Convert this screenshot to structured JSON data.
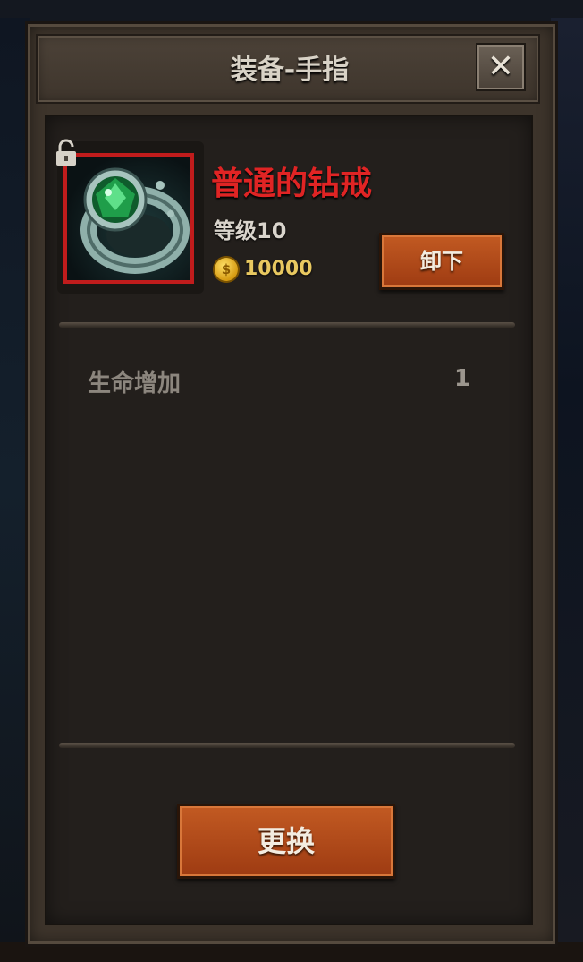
{
  "dialog": {
    "title": "装备-手指",
    "close_icon": "✕"
  },
  "item": {
    "name": "普通的钻戒",
    "level": "等级10",
    "price": "10000",
    "coin_symbol": "$",
    "icon": "ring-icon",
    "lock_icon": "unlocked-padlock-icon",
    "name_color": "#e02424",
    "frame_color": "#c01c1c"
  },
  "actions": {
    "unequip_label": "卸下",
    "replace_label": "更换"
  },
  "stats": [
    {
      "label": "生命增加",
      "value": "1"
    }
  ]
}
